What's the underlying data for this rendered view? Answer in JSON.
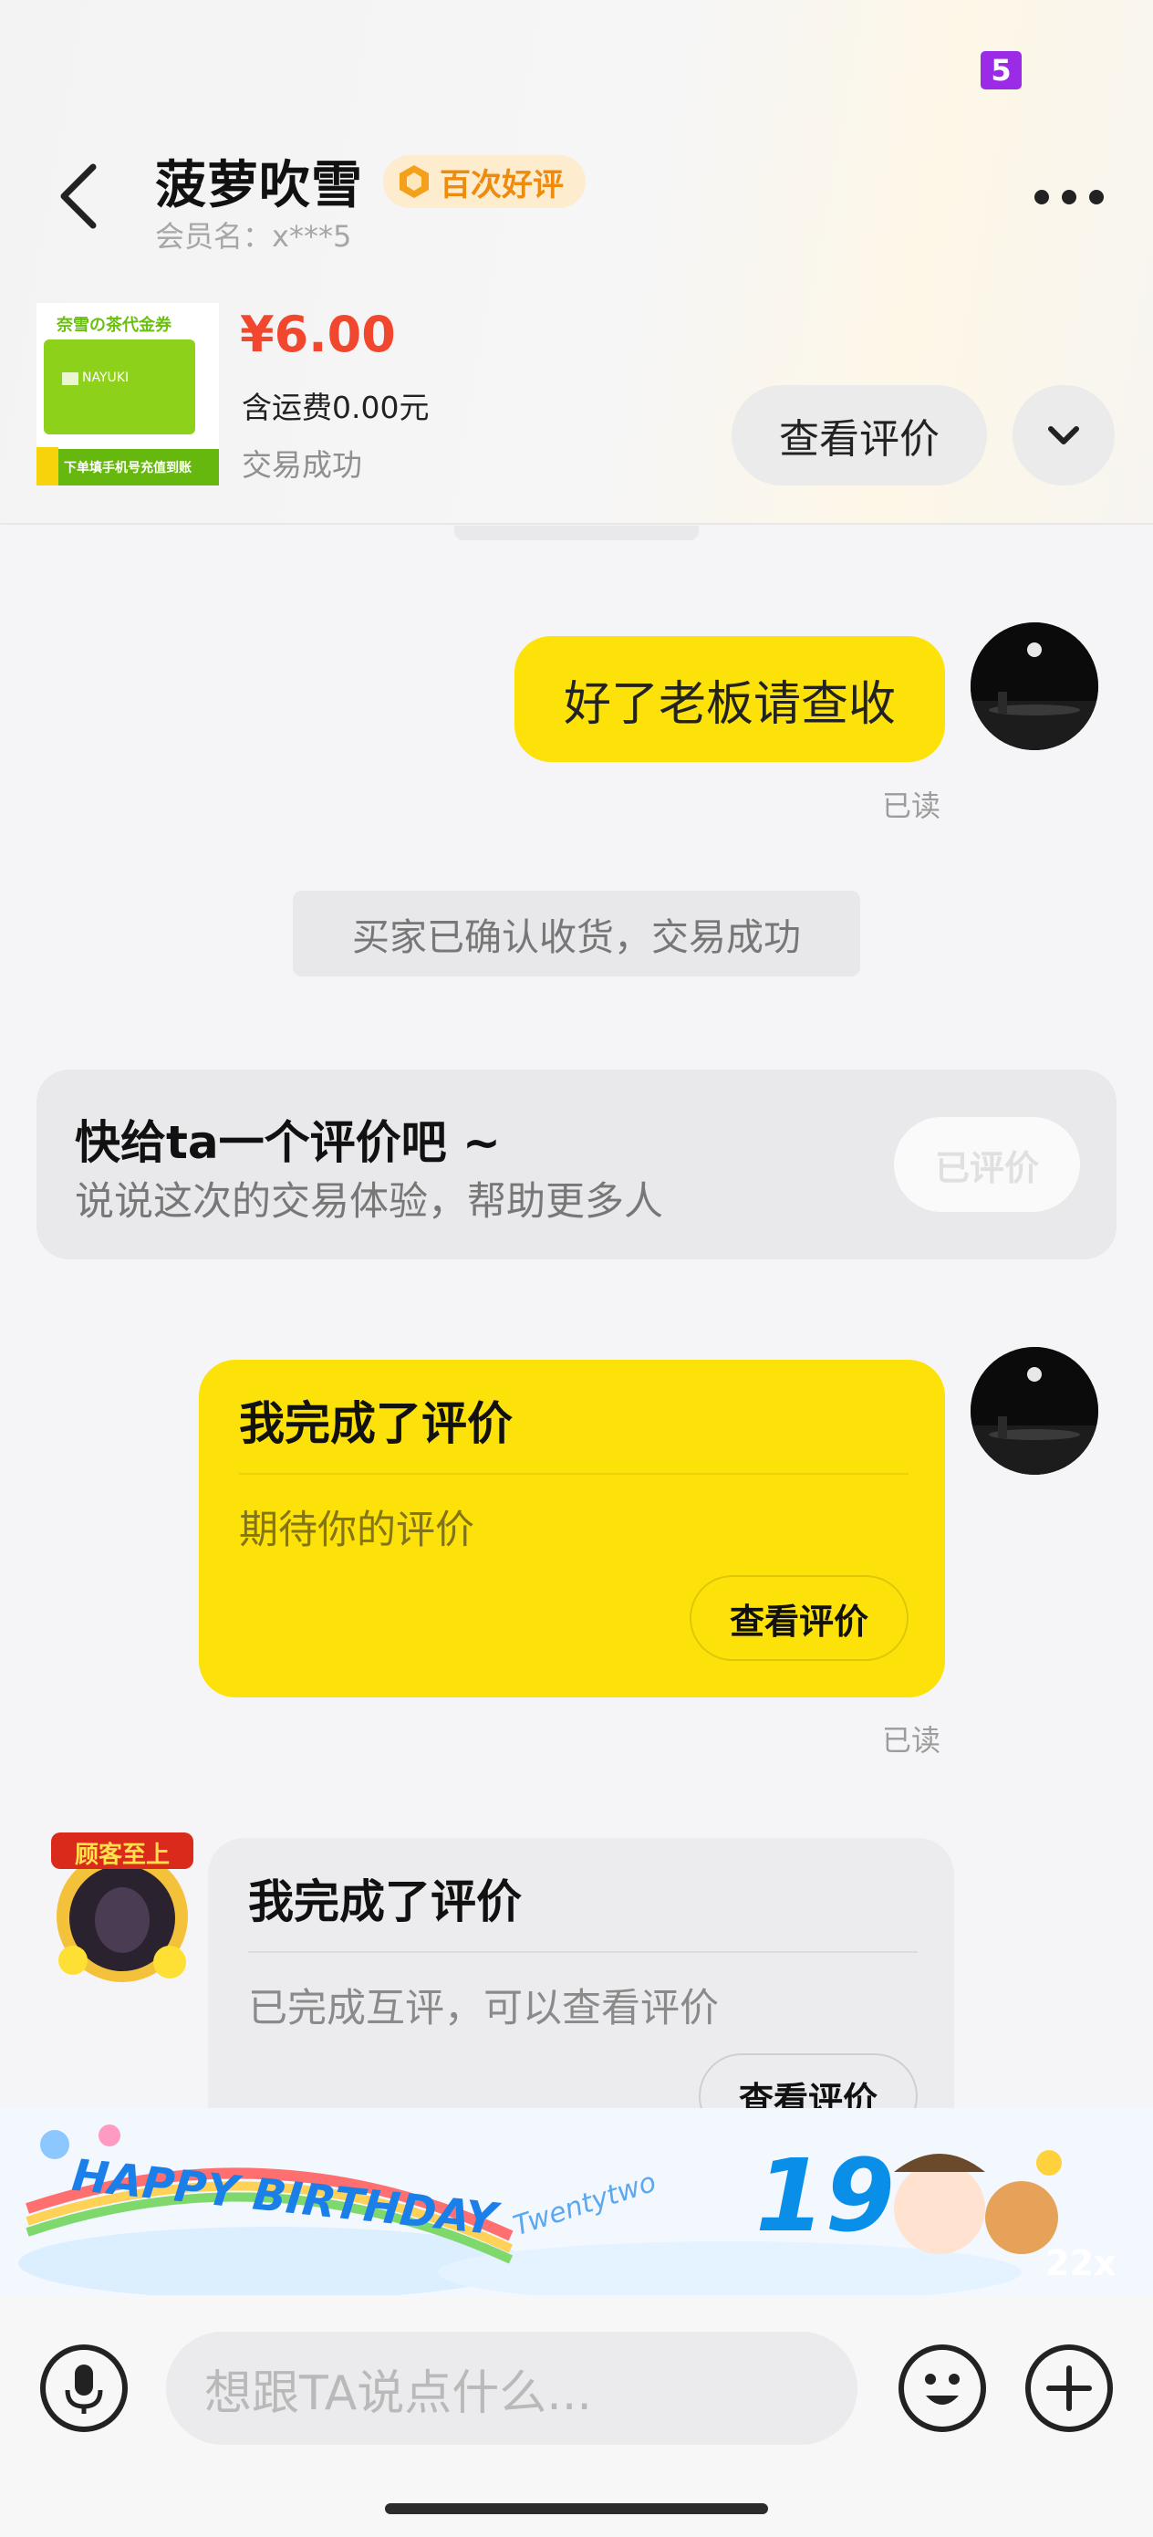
{
  "status_bar": {
    "badge": "5"
  },
  "header": {
    "title": "菠萝吹雪",
    "badge": "百次好评",
    "member": "会员名：x***5"
  },
  "product": {
    "thumb_text": "奈雪の茶代金券",
    "thumb_brand": "NAYUKI",
    "thumb_footer": "下单填手机号充值到账",
    "price": "¥6.00",
    "shipping": "含运费0.00元",
    "status": "交易成功",
    "review_button": "查看评价"
  },
  "messages": {
    "msg1": "好了老板请查收",
    "read1": "已读",
    "system": "买家已确认收货，交易成功",
    "rate_prompt": {
      "title": "快给ta一个评价吧 ~",
      "subtitle": "说说这次的交易体验，帮助更多人",
      "button": "已评价"
    },
    "eval_mine": {
      "title": "我完成了评价",
      "subtitle": "期待你的评价",
      "button": "查看评价"
    },
    "read2": "已读",
    "eval_theirs": {
      "avatar_caption": "顾客至上",
      "title": "我完成了评价",
      "subtitle": "已完成互评，可以查看评价",
      "button": "查看评价"
    }
  },
  "banner": {
    "text": "HAPPY BIRTHDAY",
    "script": "Twentytwo",
    "number": "19",
    "tag": "22x"
  },
  "input": {
    "placeholder": "想跟TA说点什么..."
  },
  "icons": [
    "back-icon",
    "more-icon",
    "chevron-down-icon",
    "mic-icon",
    "emoji-icon",
    "plus-icon"
  ],
  "colors": {
    "accent": "#fde20a",
    "price": "#f2472f",
    "badge": "#ee8a0c"
  }
}
